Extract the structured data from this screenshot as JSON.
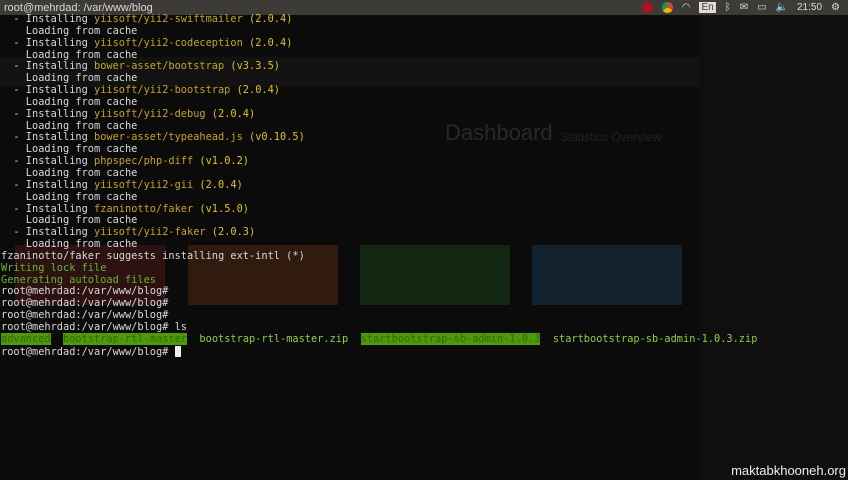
{
  "window_title": "root@mehrdad: /var/www/blog",
  "tray": {
    "lang": "En",
    "clock": "21:50"
  },
  "packages": [
    {
      "name": "yiisoft/yii2-swiftmailer",
      "version": "(2.0.4)"
    },
    {
      "name": "yiisoft/yii2-codeception",
      "version": "(2.0.4)"
    },
    {
      "name": "bower-asset/bootstrap",
      "version": "(v3.3.5)"
    },
    {
      "name": "yiisoft/yii2-bootstrap",
      "version": "(2.0.4)"
    },
    {
      "name": "yiisoft/yii2-debug",
      "version": "(2.0.4)"
    },
    {
      "name": "bower-asset/typeahead.js",
      "version": "(v0.10.5)"
    },
    {
      "name": "phpspec/php-diff",
      "version": "(v1.0.2)"
    },
    {
      "name": "yiisoft/yii2-gii",
      "version": "(2.0.4)"
    },
    {
      "name": "fzaninotto/faker",
      "version": "(v1.5.0)"
    },
    {
      "name": "yiisoft/yii2-faker",
      "version": "(2.0.3)"
    }
  ],
  "installing_label": "  - Installing ",
  "loading_label": "    Loading from cache",
  "suggest": "fzaninotto/faker suggests installing ext-intl (*)",
  "writing": "Writing lock file",
  "generating": "Generating autoload files",
  "prompt": "root@mehrdad:/var/www/blog#",
  "ls_cmd": " ls",
  "listing": [
    {
      "name": "advanced",
      "type": "dir"
    },
    {
      "name": "bootstrap-rtl-master",
      "type": "dir"
    },
    {
      "name": "bootstrap-rtl-master.zip",
      "type": "file"
    },
    {
      "name": "startbootstrap-sb-admin-1.0.3",
      "type": "dir"
    },
    {
      "name": "startbootstrap-sb-admin-1.0.3.zip",
      "type": "file"
    }
  ],
  "watermark": "maktabkhooneh.org",
  "background": {
    "heading": "Dashboard",
    "subheading": "Statistics Overview"
  }
}
